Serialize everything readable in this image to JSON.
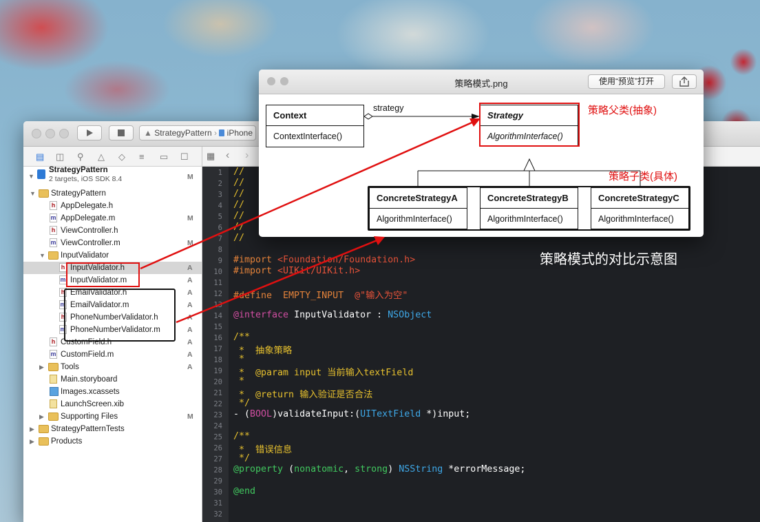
{
  "preview": {
    "title": "策略模式.png",
    "open_button": "使用“预览”打开",
    "diagram": {
      "context": {
        "name": "Context",
        "operation": "ContextInterface()"
      },
      "association_label": "strategy",
      "strategy": {
        "name": "Strategy",
        "operation": "AlgorithmInterface()"
      },
      "concretes": [
        {
          "name": "ConcreteStrategyA",
          "operation": "AlgorithmInterface()"
        },
        {
          "name": "ConcreteStrategyB",
          "operation": "AlgorithmInterface()"
        },
        {
          "name": "ConcreteStrategyC",
          "operation": "AlgorithmInterface()"
        }
      ],
      "parent_annotation": "策略父类(抽象)",
      "child_annotation": "策略子类(具体)"
    }
  },
  "caption": "策略模式的对比示意图",
  "xcode": {
    "scheme": "StrategyPattern",
    "scheme_device": "iPhone",
    "project": {
      "name": "StrategyPattern",
      "subtitle": "2 targets, iOS SDK 8.4",
      "status": "M"
    },
    "tree": [
      {
        "label": "StrategyPattern",
        "kind": "folder",
        "indent": 1,
        "open": true,
        "status": ""
      },
      {
        "label": "AppDelegate.h",
        "kind": "h",
        "indent": 2,
        "status": ""
      },
      {
        "label": "AppDelegate.m",
        "kind": "m",
        "indent": 2,
        "status": "M"
      },
      {
        "label": "ViewController.h",
        "kind": "h",
        "indent": 2,
        "status": ""
      },
      {
        "label": "ViewController.m",
        "kind": "m",
        "indent": 2,
        "status": "M"
      },
      {
        "label": "InputValidator",
        "kind": "folder",
        "indent": 2,
        "open": true,
        "status": ""
      },
      {
        "label": "InputValidator.h",
        "kind": "h",
        "indent": 3,
        "status": "A",
        "selected": true
      },
      {
        "label": "InputValidator.m",
        "kind": "m",
        "indent": 3,
        "status": "A"
      },
      {
        "label": "EmailValidator.h",
        "kind": "h",
        "indent": 3,
        "status": "A"
      },
      {
        "label": "EmailValidator.m",
        "kind": "m",
        "indent": 3,
        "status": "A"
      },
      {
        "label": "PhoneNumberValidator.h",
        "kind": "h",
        "indent": 3,
        "status": "A"
      },
      {
        "label": "PhoneNumberValidator.m",
        "kind": "m",
        "indent": 3,
        "status": "A"
      },
      {
        "label": "CustomField.h",
        "kind": "h",
        "indent": 2,
        "status": "A"
      },
      {
        "label": "CustomField.m",
        "kind": "m",
        "indent": 2,
        "status": "A"
      },
      {
        "label": "Tools",
        "kind": "folder",
        "indent": 2,
        "open": false,
        "status": "A"
      },
      {
        "label": "Main.storyboard",
        "kind": "doc",
        "indent": 2,
        "status": ""
      },
      {
        "label": "Images.xcassets",
        "kind": "assets",
        "indent": 2,
        "status": ""
      },
      {
        "label": "LaunchScreen.xib",
        "kind": "doc",
        "indent": 2,
        "status": ""
      },
      {
        "label": "Supporting Files",
        "kind": "folder",
        "indent": 2,
        "open": false,
        "status": "M"
      },
      {
        "label": "StrategyPatternTests",
        "kind": "folder",
        "indent": 1,
        "open": false,
        "status": ""
      },
      {
        "label": "Products",
        "kind": "folder",
        "indent": 1,
        "open": false,
        "status": ""
      }
    ],
    "line_numbers": [
      "1",
      "2",
      "3",
      "4",
      "5",
      "6",
      "7",
      "8",
      "9",
      "10",
      "11",
      "12",
      "13",
      "14",
      "15",
      "16",
      "17",
      "18",
      "19",
      "20",
      "21",
      "22",
      "23",
      "24",
      "25",
      "26",
      "27",
      "28",
      "29",
      "30",
      "31",
      "32"
    ],
    "code": {
      "l1": "//",
      "l2": "//",
      "l3": "//",
      "l4": "//",
      "l5": "//",
      "l6": "//",
      "l7": "//",
      "l9_kw": "#import ",
      "l9_str": "<Foundation/Foundation.h>",
      "l10_kw": "#import ",
      "l10_str": "<UIKit/UIKit.h>",
      "l12_kw": "#define  EMPTY_INPUT  ",
      "l12_str": "@\"输入为空\"",
      "l14_a": "@interface",
      "l14_b": " InputValidator : ",
      "l14_c": "NSObject",
      "l16": "/**",
      "l17": " *  抽象策略",
      "l18": " *",
      "l19": " *  @param input 当前输入textField",
      "l20": " *",
      "l21": " *  @return 输入验证是否合法",
      "l22": " */",
      "l23_a": "- (",
      "l23_b": "BOOL",
      "l23_c": ")validateInput:(",
      "l23_d": "UITextField",
      "l23_e": " *)input;",
      "l25": "/**",
      "l26": " *  错误信息",
      "l27": " */",
      "l28_a": "@property",
      "l28_b": " (",
      "l28_c": "nonatomic",
      "l28_d": ", ",
      "l28_e": "strong",
      "l28_f": ") ",
      "l28_g": "NSString",
      "l28_h": " *errorMessage;",
      "l30": "@end"
    }
  },
  "colors": {
    "annotation_red": "#e01010",
    "comment": "#e6c02e",
    "keyword": "#d14ea2",
    "type": "#3ea8e8"
  }
}
